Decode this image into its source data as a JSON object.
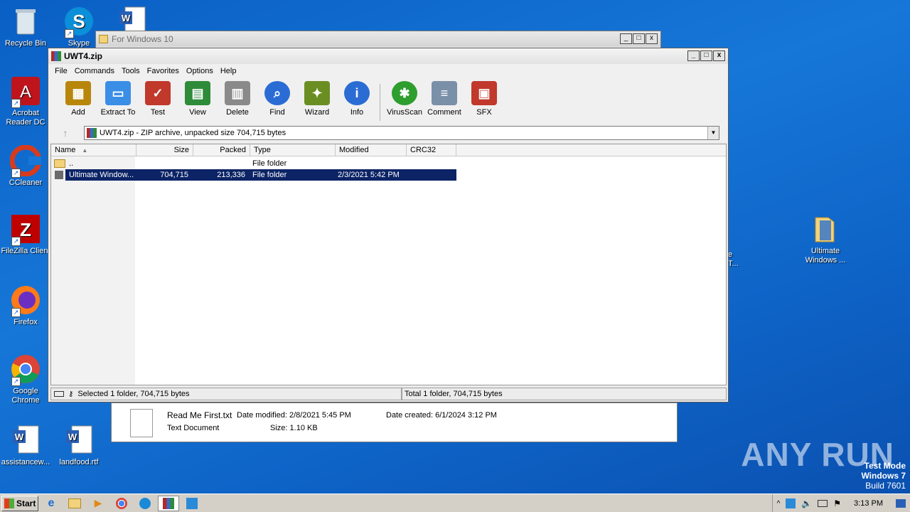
{
  "desktop": {
    "icons_left": [
      {
        "label": "Recycle Bin"
      },
      {
        "label": "Skype"
      },
      {
        "label": "Acrobat Reader DC"
      },
      {
        "label": "CCleaner"
      },
      {
        "label": "FileZilla Client"
      },
      {
        "label": "Firefox"
      },
      {
        "label": "Google Chrome"
      },
      {
        "label": "assistancew..."
      },
      {
        "label": "landfood.rtf"
      }
    ],
    "icon_right": {
      "label": "Ultimate Windows ..."
    },
    "partial_label_1": "e",
    "partial_label_2": "T..."
  },
  "background_window": {
    "title": "For Windows 10"
  },
  "window": {
    "title": "UWT4.zip",
    "caption_min": "_",
    "caption_max": "□",
    "caption_close": "x",
    "menu": [
      "File",
      "Commands",
      "Tools",
      "Favorites",
      "Options",
      "Help"
    ],
    "toolbar": [
      {
        "label": "Add",
        "color": "#b8860b"
      },
      {
        "label": "Extract To",
        "color": "#3a8ee6"
      },
      {
        "label": "Test",
        "color": "#c0392b"
      },
      {
        "label": "View",
        "color": "#2e8b3a"
      },
      {
        "label": "Delete",
        "color": "#8a8a8a"
      },
      {
        "label": "Find",
        "color": "#2b6cd4"
      },
      {
        "label": "Wizard",
        "color": "#6b8e23"
      },
      {
        "label": "Info",
        "color": "#2b6cd4"
      },
      {
        "label": "VirusScan",
        "color": "#2e9e2e"
      },
      {
        "label": "Comment",
        "color": "#7a8fa8"
      },
      {
        "label": "SFX",
        "color": "#c0392b"
      }
    ],
    "address": "UWT4.zip - ZIP archive, unpacked size 704,715 bytes",
    "columns": [
      "Name",
      "Size",
      "Packed",
      "Type",
      "Modified",
      "CRC32"
    ],
    "rows": [
      {
        "name": "..",
        "size": "",
        "packed": "",
        "type": "File folder",
        "modified": "",
        "crc": ""
      },
      {
        "name": "Ultimate Window...",
        "size": "704,715",
        "packed": "213,336",
        "type": "File folder",
        "modified": "2/3/2021 5:42 PM",
        "crc": ""
      }
    ],
    "status_left": "Selected 1 folder, 704,715 bytes",
    "status_right": "Total 1 folder, 704,715 bytes"
  },
  "details_pane": {
    "filename": "Read Me First.txt",
    "date_modified_label": "Date modified:",
    "date_modified": "2/8/2021 5:45 PM",
    "date_created_label": "Date created:",
    "date_created": "6/1/2024 3:12 PM",
    "type": "Text Document",
    "size_label": "Size:",
    "size": "1.10 KB"
  },
  "taskbar": {
    "start": "Start",
    "clock": "3:13 PM"
  },
  "watermark": "ANY RUN",
  "test_mode": {
    "line1": "Test Mode",
    "line2": "Windows 7",
    "line3": "Build 7601"
  }
}
